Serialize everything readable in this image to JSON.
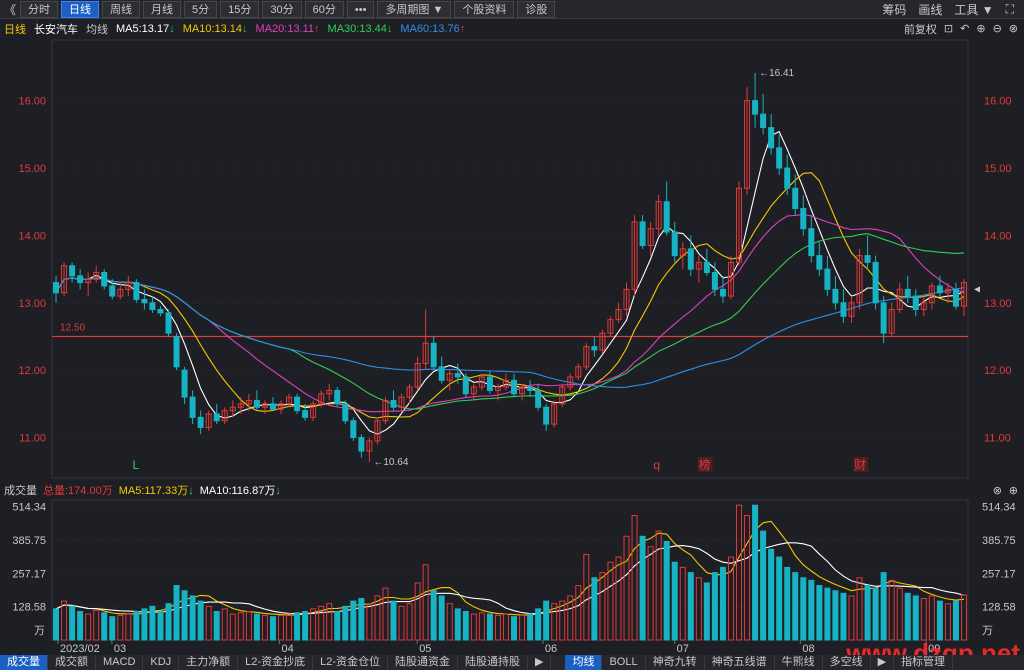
{
  "toolbar": {
    "back": "《",
    "periods": [
      "分时",
      "日线",
      "周线",
      "月线",
      "5分",
      "15分",
      "30分",
      "60分",
      "•••",
      "多周期图 ▼",
      "个股资料",
      "诊股"
    ],
    "active": 1,
    "right": [
      "筹码",
      "画线",
      "工具 ▼",
      "⛶"
    ]
  },
  "info": {
    "period": "日线",
    "name": "长安汽车",
    "type": "均线",
    "ma5": "MA5:13.17",
    "ma10": "MA10:13.14",
    "ma20": "MA20:13.11",
    "ma30": "MA30:13.44",
    "ma60": "MA60:13.76",
    "adjust": "前复权"
  },
  "colors": {
    "up": "#e03a3a",
    "down": "#17b3c4",
    "ma5": "#ffffff",
    "ma10": "#f5c800",
    "ma20": "#e040c0",
    "ma30": "#2fcf55",
    "ma60": "#2f8fe8",
    "axis": "#e03a3a",
    "hline": "#e03a3a"
  },
  "volume_info": {
    "label": "成交量",
    "total": "总量:174.00万",
    "ma5": "MA5:117.33万",
    "ma10": "MA10:116.87万"
  },
  "chart_data": {
    "type": "candlestick",
    "price_axis_ticks": [
      "16.00",
      "15.00",
      "14.00",
      "13.00",
      "12.00",
      "11.00"
    ],
    "price_axis_values": [
      16,
      15,
      14,
      13,
      12,
      11
    ],
    "price_range": [
      10.4,
      16.9
    ],
    "horizontal_line": {
      "label": "12.50",
      "value": 12.5
    },
    "annotations": [
      {
        "text": "16.41",
        "value": 16.41
      },
      {
        "text": "10.64",
        "value": 10.64
      }
    ],
    "event_markers": [
      "L",
      "q",
      "榜",
      "财"
    ],
    "volume_axis_ticks": [
      "514.34",
      "385.75",
      "257.17",
      "128.58"
    ],
    "volume_axis_values": [
      514.34,
      385.75,
      257.17,
      128.58
    ],
    "volume_unit": "万",
    "volume_range": [
      0,
      540
    ],
    "x_labels": [
      "2023/02",
      "03",
      "04",
      "05",
      "06",
      "07",
      "08",
      "09"
    ],
    "candles": [
      [
        13.3,
        13.4,
        13.0,
        13.15,
        120
      ],
      [
        13.15,
        13.6,
        13.1,
        13.55,
        150
      ],
      [
        13.55,
        13.6,
        13.3,
        13.4,
        130
      ],
      [
        13.4,
        13.5,
        13.2,
        13.3,
        110
      ],
      [
        13.3,
        13.45,
        13.1,
        13.35,
        100
      ],
      [
        13.35,
        13.55,
        13.3,
        13.45,
        115
      ],
      [
        13.45,
        13.5,
        13.2,
        13.25,
        105
      ],
      [
        13.25,
        13.35,
        13.05,
        13.1,
        90
      ],
      [
        13.1,
        13.3,
        13.05,
        13.2,
        95
      ],
      [
        13.2,
        13.4,
        13.1,
        13.3,
        100
      ],
      [
        13.3,
        13.35,
        13.0,
        13.05,
        110
      ],
      [
        13.05,
        13.2,
        12.9,
        13.0,
        120
      ],
      [
        13.0,
        13.1,
        12.85,
        12.9,
        130
      ],
      [
        12.9,
        12.95,
        12.8,
        12.85,
        110
      ],
      [
        12.85,
        12.9,
        12.5,
        12.55,
        140
      ],
      [
        12.5,
        12.55,
        12.0,
        12.05,
        210
      ],
      [
        12.0,
        12.05,
        11.5,
        11.6,
        190
      ],
      [
        11.6,
        11.7,
        11.2,
        11.3,
        170
      ],
      [
        11.3,
        11.4,
        11.05,
        11.15,
        150
      ],
      [
        11.15,
        11.4,
        11.1,
        11.35,
        130
      ],
      [
        11.35,
        11.5,
        11.2,
        11.25,
        110
      ],
      [
        11.25,
        11.45,
        11.2,
        11.4,
        120
      ],
      [
        11.4,
        11.55,
        11.3,
        11.45,
        100
      ],
      [
        11.45,
        11.6,
        11.35,
        11.5,
        105
      ],
      [
        11.5,
        11.65,
        11.4,
        11.55,
        110
      ],
      [
        11.55,
        11.7,
        11.4,
        11.45,
        100
      ],
      [
        11.45,
        11.55,
        11.35,
        11.5,
        95
      ],
      [
        11.5,
        11.6,
        11.4,
        11.42,
        90
      ],
      [
        11.42,
        11.55,
        11.35,
        11.5,
        95
      ],
      [
        11.5,
        11.65,
        11.45,
        11.6,
        100
      ],
      [
        11.6,
        11.65,
        11.35,
        11.4,
        105
      ],
      [
        11.4,
        11.5,
        11.25,
        11.3,
        110
      ],
      [
        11.3,
        11.55,
        11.25,
        11.5,
        120
      ],
      [
        11.5,
        11.7,
        11.45,
        11.65,
        130
      ],
      [
        11.65,
        11.8,
        11.55,
        11.7,
        140
      ],
      [
        11.7,
        11.75,
        11.45,
        11.5,
        110
      ],
      [
        11.5,
        11.55,
        11.2,
        11.25,
        130
      ],
      [
        11.25,
        11.3,
        10.95,
        11.0,
        150
      ],
      [
        11.0,
        11.05,
        10.7,
        10.8,
        160
      ],
      [
        10.8,
        11.0,
        10.64,
        10.95,
        140
      ],
      [
        10.95,
        11.3,
        10.9,
        11.25,
        170
      ],
      [
        11.25,
        11.6,
        11.2,
        11.55,
        200
      ],
      [
        11.55,
        11.7,
        11.4,
        11.45,
        150
      ],
      [
        11.45,
        11.65,
        11.4,
        11.6,
        130
      ],
      [
        11.6,
        11.8,
        11.5,
        11.75,
        140
      ],
      [
        11.75,
        12.2,
        11.7,
        12.1,
        220
      ],
      [
        12.1,
        12.9,
        12.0,
        12.4,
        290
      ],
      [
        12.4,
        12.5,
        12.0,
        12.05,
        190
      ],
      [
        12.05,
        12.2,
        11.8,
        11.85,
        170
      ],
      [
        11.85,
        12.0,
        11.7,
        11.95,
        140
      ],
      [
        11.95,
        12.1,
        11.8,
        11.9,
        120
      ],
      [
        11.9,
        11.95,
        11.6,
        11.65,
        110
      ],
      [
        11.65,
        11.8,
        11.55,
        11.75,
        100
      ],
      [
        11.75,
        11.95,
        11.7,
        11.9,
        105
      ],
      [
        11.9,
        12.0,
        11.65,
        11.7,
        100
      ],
      [
        11.7,
        11.8,
        11.55,
        11.75,
        95
      ],
      [
        11.75,
        11.95,
        11.7,
        11.85,
        100
      ],
      [
        11.85,
        11.95,
        11.6,
        11.65,
        90
      ],
      [
        11.65,
        11.8,
        11.55,
        11.75,
        95
      ],
      [
        11.75,
        11.85,
        11.6,
        11.7,
        100
      ],
      [
        11.7,
        11.8,
        11.4,
        11.45,
        120
      ],
      [
        11.45,
        11.5,
        11.1,
        11.2,
        150
      ],
      [
        11.2,
        11.55,
        11.15,
        11.5,
        140
      ],
      [
        11.5,
        11.8,
        11.45,
        11.75,
        150
      ],
      [
        11.75,
        11.95,
        11.7,
        11.9,
        170
      ],
      [
        11.9,
        12.1,
        11.85,
        12.05,
        210
      ],
      [
        12.05,
        12.4,
        12.0,
        12.35,
        330
      ],
      [
        12.35,
        12.5,
        12.2,
        12.3,
        240
      ],
      [
        12.3,
        12.6,
        12.25,
        12.55,
        260
      ],
      [
        12.55,
        12.8,
        12.5,
        12.75,
        300
      ],
      [
        12.75,
        13.0,
        12.7,
        12.9,
        320
      ],
      [
        12.9,
        13.3,
        12.8,
        13.2,
        400
      ],
      [
        13.2,
        14.3,
        13.1,
        14.2,
        480
      ],
      [
        14.2,
        14.3,
        13.8,
        13.85,
        400
      ],
      [
        13.85,
        14.2,
        13.7,
        14.1,
        360
      ],
      [
        14.1,
        14.6,
        14.0,
        14.5,
        420
      ],
      [
        14.5,
        14.8,
        14.0,
        14.05,
        380
      ],
      [
        14.05,
        14.2,
        13.6,
        13.7,
        300
      ],
      [
        13.7,
        13.9,
        13.5,
        13.8,
        280
      ],
      [
        13.8,
        14.0,
        13.4,
        13.5,
        260
      ],
      [
        13.5,
        13.7,
        13.3,
        13.6,
        240
      ],
      [
        13.6,
        13.8,
        13.4,
        13.45,
        220
      ],
      [
        13.45,
        13.6,
        13.1,
        13.2,
        260
      ],
      [
        13.2,
        13.4,
        13.0,
        13.1,
        280
      ],
      [
        13.1,
        13.7,
        13.05,
        13.6,
        320
      ],
      [
        13.6,
        14.8,
        13.55,
        14.7,
        520
      ],
      [
        14.7,
        16.2,
        14.6,
        16.0,
        480
      ],
      [
        16.0,
        16.41,
        15.6,
        15.8,
        520
      ],
      [
        15.8,
        16.1,
        15.5,
        15.6,
        420
      ],
      [
        15.6,
        15.8,
        15.2,
        15.3,
        350
      ],
      [
        15.3,
        15.5,
        14.9,
        15.0,
        320
      ],
      [
        15.0,
        15.2,
        14.6,
        14.7,
        280
      ],
      [
        14.7,
        14.9,
        14.3,
        14.4,
        260
      ],
      [
        14.4,
        14.6,
        14.0,
        14.1,
        240
      ],
      [
        14.1,
        14.3,
        13.6,
        13.7,
        230
      ],
      [
        13.7,
        13.9,
        13.4,
        13.5,
        210
      ],
      [
        13.5,
        13.7,
        13.1,
        13.2,
        200
      ],
      [
        13.2,
        13.4,
        12.9,
        13.0,
        190
      ],
      [
        13.0,
        13.2,
        12.7,
        12.8,
        180
      ],
      [
        12.8,
        13.1,
        12.7,
        13.0,
        170
      ],
      [
        13.0,
        13.8,
        12.9,
        13.7,
        240
      ],
      [
        13.7,
        14.0,
        13.5,
        13.6,
        210
      ],
      [
        13.6,
        13.7,
        12.9,
        13.0,
        200
      ],
      [
        13.0,
        13.1,
        12.4,
        12.55,
        260
      ],
      [
        12.55,
        13.0,
        12.5,
        12.9,
        230
      ],
      [
        12.9,
        13.3,
        12.85,
        13.2,
        200
      ],
      [
        13.2,
        13.4,
        13.0,
        13.1,
        180
      ],
      [
        13.1,
        13.2,
        12.8,
        12.9,
        170
      ],
      [
        12.9,
        13.1,
        12.8,
        13.0,
        160
      ],
      [
        13.0,
        13.3,
        12.9,
        13.25,
        170
      ],
      [
        13.25,
        13.4,
        13.1,
        13.15,
        150
      ],
      [
        13.15,
        13.3,
        13.0,
        13.2,
        140
      ],
      [
        13.2,
        13.3,
        12.9,
        12.95,
        150
      ],
      [
        12.95,
        13.35,
        12.8,
        13.3,
        174
      ]
    ]
  },
  "bottom_tabs": [
    "成交量",
    "成交额",
    "MACD",
    "KDJ",
    "主力净额",
    "L2-资金抄底",
    "L2-资金仓位",
    "陆股通资金",
    "陆股通持股",
    "▶",
    "均线",
    "BOLL",
    "神奇九转",
    "神奇五线谱",
    "牛熊线",
    "多空线",
    "▶",
    "指标管理"
  ],
  "bottom_selected": [
    0,
    10
  ],
  "watermark": "www.dzgp.net"
}
